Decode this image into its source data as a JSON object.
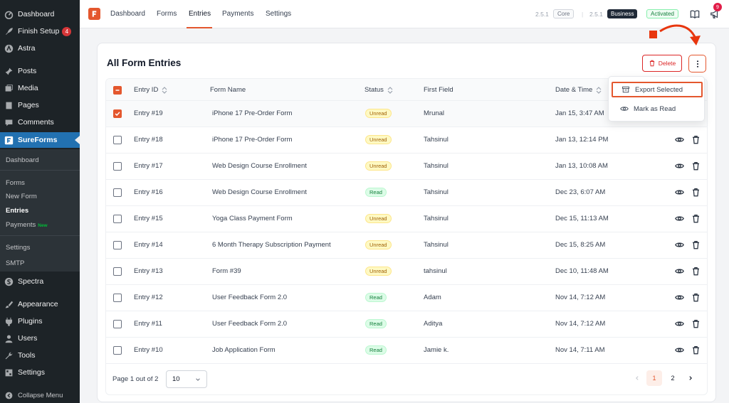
{
  "sidebar": {
    "items_top": [
      {
        "label": "Dashboard",
        "icon": "dashboard-icon"
      },
      {
        "label": "Finish Setup",
        "icon": "rocket-icon",
        "badge": "4"
      },
      {
        "label": "Astra",
        "icon": "astra-icon"
      },
      {
        "label": "Posts",
        "icon": "pin-icon"
      },
      {
        "label": "Media",
        "icon": "media-icon"
      },
      {
        "label": "Pages",
        "icon": "pages-icon"
      },
      {
        "label": "Comments",
        "icon": "comment-icon"
      },
      {
        "label": "SureForms",
        "icon": "sureforms-icon"
      }
    ],
    "submenu": {
      "dashboard": "Dashboard",
      "forms": "Forms",
      "new_form": "New Form",
      "entries": "Entries",
      "payments": "Payments",
      "payments_tag": "New",
      "settings": "Settings",
      "smtp": "SMTP"
    },
    "items_bottom": [
      {
        "label": "Spectra",
        "icon": "spectra-icon"
      },
      {
        "label": "Appearance",
        "icon": "brush-icon"
      },
      {
        "label": "Plugins",
        "icon": "plugin-icon"
      },
      {
        "label": "Users",
        "icon": "users-icon"
      },
      {
        "label": "Tools",
        "icon": "wrench-icon"
      },
      {
        "label": "Settings",
        "icon": "settings-icon"
      },
      {
        "label": "Collapse Menu",
        "icon": "collapse-icon"
      }
    ]
  },
  "topbar": {
    "tabs": [
      "Dashboard",
      "Forms",
      "Entries",
      "Payments",
      "Settings"
    ],
    "active_tab": "Entries",
    "core_version": "2.5.1",
    "core_label": "Core",
    "separator": "|",
    "business_version": "2.5.1",
    "business_label": "Business",
    "activated_label": "Activated",
    "notification_count": "9"
  },
  "card": {
    "title": "All Form Entries",
    "delete_label": "Delete"
  },
  "table": {
    "headers": {
      "entry_id": "Entry ID",
      "form_name": "Form Name",
      "status": "Status",
      "first_field": "First Field",
      "date_time": "Date & Time"
    },
    "rows": [
      {
        "entry": "Entry #19",
        "form": "iPhone 17 Pre-Order Form",
        "status": "Unread",
        "first": "Mrunal",
        "date": "Jan 15, 3:47 AM",
        "checked": true
      },
      {
        "entry": "Entry #18",
        "form": "iPhone 17 Pre-Order Form",
        "status": "Unread",
        "first": "Tahsinul",
        "date": "Jan 13, 12:14 PM",
        "checked": false
      },
      {
        "entry": "Entry #17",
        "form": "Web Design Course Enrollment",
        "status": "Unread",
        "first": "Tahsinul",
        "date": "Jan 13, 10:08 AM",
        "checked": false
      },
      {
        "entry": "Entry #16",
        "form": "Web Design Course Enrollment",
        "status": "Read",
        "first": "Tahsinul",
        "date": "Dec 23, 6:07 AM",
        "checked": false
      },
      {
        "entry": "Entry #15",
        "form": "Yoga Class Payment Form",
        "status": "Unread",
        "first": "Tahsinul",
        "date": "Dec 15, 11:13 AM",
        "checked": false
      },
      {
        "entry": "Entry #14",
        "form": "6 Month Therapy Subscription Payment",
        "status": "Unread",
        "first": "Tahsinul",
        "date": "Dec 15, 8:25 AM",
        "checked": false
      },
      {
        "entry": "Entry #13",
        "form": "Form #39",
        "status": "Unread",
        "first": "tahsinul",
        "date": "Dec 10, 11:48 AM",
        "checked": false
      },
      {
        "entry": "Entry #12",
        "form": "User Feedback Form 2.0",
        "status": "Read",
        "first": "Adam",
        "date": "Nov 14, 7:12 AM",
        "checked": false
      },
      {
        "entry": "Entry #11",
        "form": "User Feedback Form 2.0",
        "status": "Read",
        "first": "Aditya",
        "date": "Nov 14, 7:12 AM",
        "checked": false
      },
      {
        "entry": "Entry #10",
        "form": "Job Application Form",
        "status": "Read",
        "first": "Jamie k.",
        "date": "Nov 14, 7:11 AM",
        "checked": false
      }
    ]
  },
  "pagination": {
    "label": "Page 1 out of 2",
    "per_page": "10",
    "pages": [
      "1",
      "2"
    ],
    "current": "1"
  },
  "dropdown": {
    "export_selected": "Export Selected",
    "mark_as_read": "Mark as Read"
  },
  "colors": {
    "accent": "#e4572e",
    "sidebar_bg": "#1d2327",
    "sidebar_active": "#2271b1",
    "annotation_red": "#e8360e"
  }
}
